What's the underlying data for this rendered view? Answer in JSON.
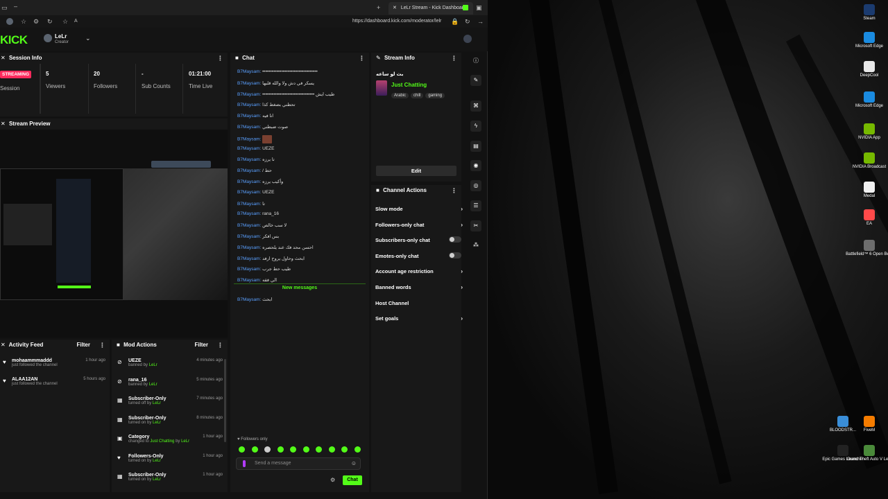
{
  "browser": {
    "tab_title": "LeLr Stream - Kick Dashboard",
    "url": "https://dashboard.kick.com/moderator/lelr"
  },
  "header": {
    "logo": "KICK",
    "user_name": "LeLr",
    "user_role": "Creator"
  },
  "session_info": {
    "title": "Session Info",
    "status_badge": "STREAMING",
    "session_label": "Session",
    "stats": [
      {
        "value": "5",
        "label": "Viewers"
      },
      {
        "value": "20",
        "label": "Followers"
      },
      {
        "value": "-",
        "label": "Sub Counts"
      },
      {
        "value": "01:21:00",
        "label": "Time Live"
      }
    ]
  },
  "stream_preview": {
    "title": "Stream Preview"
  },
  "activity_feed": {
    "title": "Activity Feed",
    "filter_label": "Filter",
    "items": [
      {
        "name": "mohaammmaddd",
        "desc": "just followed the channel",
        "time": "1 hour ago"
      },
      {
        "name": "ALAA12AN",
        "desc": "just followed the channel",
        "time": "5 hours ago"
      }
    ]
  },
  "mod_actions": {
    "title": "Mod Actions",
    "filter_label": "Filter",
    "items": [
      {
        "title": "UEZE",
        "desc": "banned by",
        "by": "LeLr",
        "time": "4 minutes ago"
      },
      {
        "title": "rana_16",
        "desc": "banned by",
        "by": "LeLr",
        "time": "5 minutes ago"
      },
      {
        "title": "Subscriber-Only",
        "desc": "turned off by",
        "by": "LeLr",
        "time": "7 minutes ago"
      },
      {
        "title": "Subscriber-Only",
        "desc": "turned on by",
        "by": "LeLr",
        "time": "8 minutes ago"
      },
      {
        "title": "Category",
        "desc": "changed to",
        "extra": "Just Chatting",
        "desc2": "by",
        "by": "LeLr",
        "time": "1 hour ago"
      },
      {
        "title": "Followers-Only",
        "desc": "turned on by",
        "by": "LeLr",
        "time": "1 hour ago"
      },
      {
        "title": "Subscriber-Only",
        "desc": "turned on by",
        "by": "LeLr",
        "time": "1 hour ago"
      }
    ]
  },
  "chat": {
    "title": "Chat",
    "user": "B7Maysam:",
    "messages": [
      "•••••••••••••••••••••••••••••••••••",
      "يسكر في دش ولا والله قلبها",
      "••••••••••••••••••••••••••••••••• طيب ايش",
      "تحطني بضغط كذا",
      "انا فيه",
      "صوت ضبطني",
      "",
      "UEZE",
      "تا يرزه",
      "/ حط",
      "وأكيب يرزه",
      "UEZE",
      "تا",
      "rana_16",
      "لا سب خالص",
      "بس افكر",
      "احسن محد فك عند يلحصره",
      "ابحث وحاول يروح ارفد",
      "طيب حط جرب",
      "الي فقه"
    ],
    "new_messages_label": "New messages",
    "after_new": "ابحث",
    "followers_only": "Followers only",
    "placeholder": "Send a message",
    "send_label": "Chat"
  },
  "stream_info": {
    "title": "Stream Info",
    "stream_title": "بث لو ساعه",
    "category": "Just Chatting",
    "tags": [
      "Arabic",
      "chill",
      "gaming"
    ],
    "edit_label": "Edit"
  },
  "channel_actions": {
    "title": "Channel Actions",
    "items": [
      {
        "label": "Slow mode",
        "type": "chevron"
      },
      {
        "label": "Followers-only chat",
        "type": "chevron"
      },
      {
        "label": "Subscribers-only chat",
        "type": "toggle"
      },
      {
        "label": "Emotes-only chat",
        "type": "toggle"
      },
      {
        "label": "Account age restriction",
        "type": "chevron"
      },
      {
        "label": "Banned words",
        "type": "chevron"
      },
      {
        "label": "Host Channel",
        "type": "none"
      },
      {
        "label": "Set goals",
        "type": "chevron"
      }
    ]
  },
  "desktop_icons": [
    {
      "label": "Steam",
      "color": "#1b3b6f"
    },
    {
      "label": "Microsoft Edge",
      "color": "#1a8be0"
    },
    {
      "label": "DeepCool",
      "color": "#e8e8e8"
    },
    {
      "label": "Microsoft Edge",
      "color": "#1a8be0"
    },
    {
      "label": "NVIDIA App",
      "color": "#76b900"
    },
    {
      "label": "NVIDIA Broadcast",
      "color": "#76b900"
    },
    {
      "label": "Medal",
      "color": "#f0f0f0"
    },
    {
      "label": "EA",
      "color": "#ff4a4a"
    },
    {
      "label": "Battlefield™ 6 Open Beta",
      "color": "#6d6d6d"
    },
    {
      "label": "BLOODSTR...",
      "color": "#3a8ed8"
    },
    {
      "label": "FiveM",
      "color": "#f57c00"
    },
    {
      "label": "Epic Games Launcher",
      "color": "#222222"
    },
    {
      "label": "Grand Theft Auto V Le...",
      "color": "#4a8a3a"
    }
  ]
}
